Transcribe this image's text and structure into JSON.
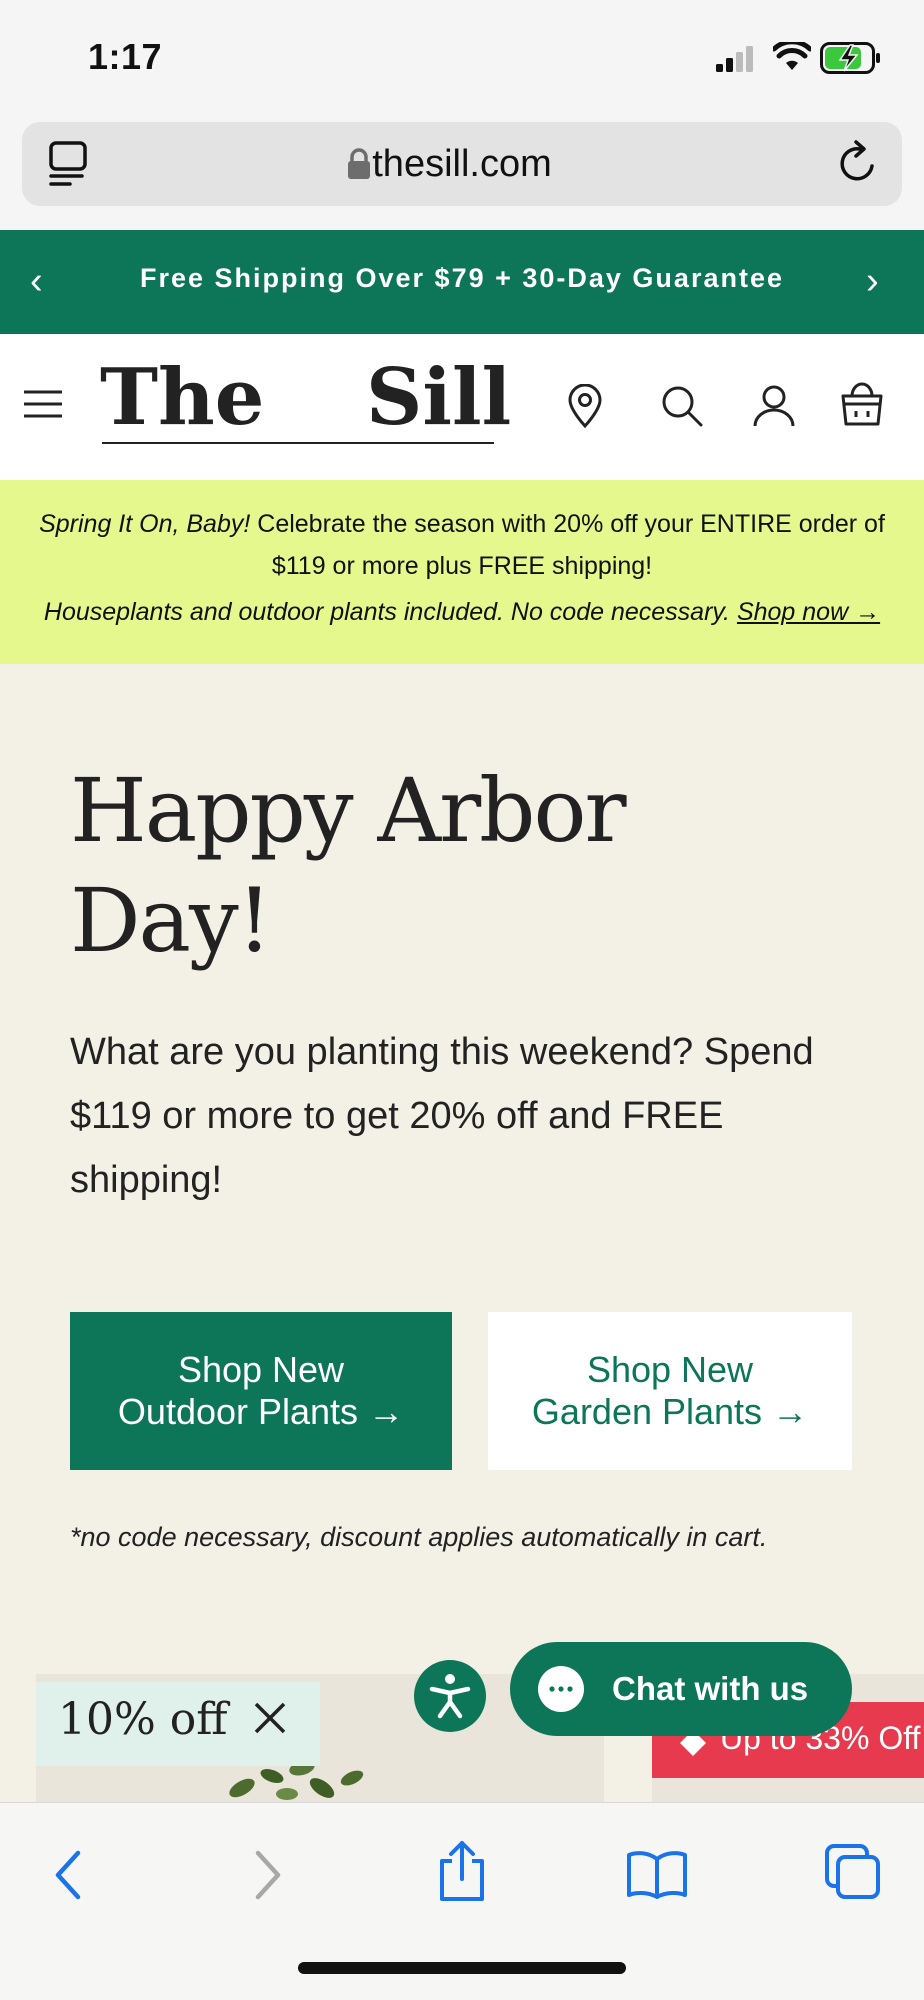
{
  "status": {
    "time": "1:17"
  },
  "browser": {
    "url": "thesill.com"
  },
  "banner": {
    "text": "Free Shipping Over $79 + 30-Day Guarantee"
  },
  "header": {
    "logo_the": "The",
    "logo_sill": "Sill"
  },
  "promo": {
    "line1_italic": "Spring It On, Baby!",
    "line1_rest": " Celebrate the season with 20% off your ENTIRE order of",
    "line2": "$119 or more plus FREE shipping!",
    "line3": "Houseplants and outdoor plants included. No code necessary. ",
    "link": "Shop now →"
  },
  "hero": {
    "title_line1": "Happy Arbor",
    "title_line2": "Day!",
    "body": "What are you planting this weekend? Spend $119 or more to get 20% off and FREE shipping!",
    "button_outdoor_line1": "Shop New",
    "button_outdoor_line2": "Outdoor Plants →",
    "button_garden_line1": "Shop New",
    "button_garden_line2": "Garden Plants →",
    "disclaimer": "*no code necessary, discount applies automatically in cart."
  },
  "products": {
    "badge_left": "10% off",
    "badge_right": "Up to 33% Off"
  },
  "chat": {
    "label": "Chat with us"
  },
  "colors": {
    "brand_green": "#0d7558",
    "promo_yellow": "#e4f88d",
    "sale_red": "#e83a4f",
    "ios_blue": "#1a73e8"
  }
}
